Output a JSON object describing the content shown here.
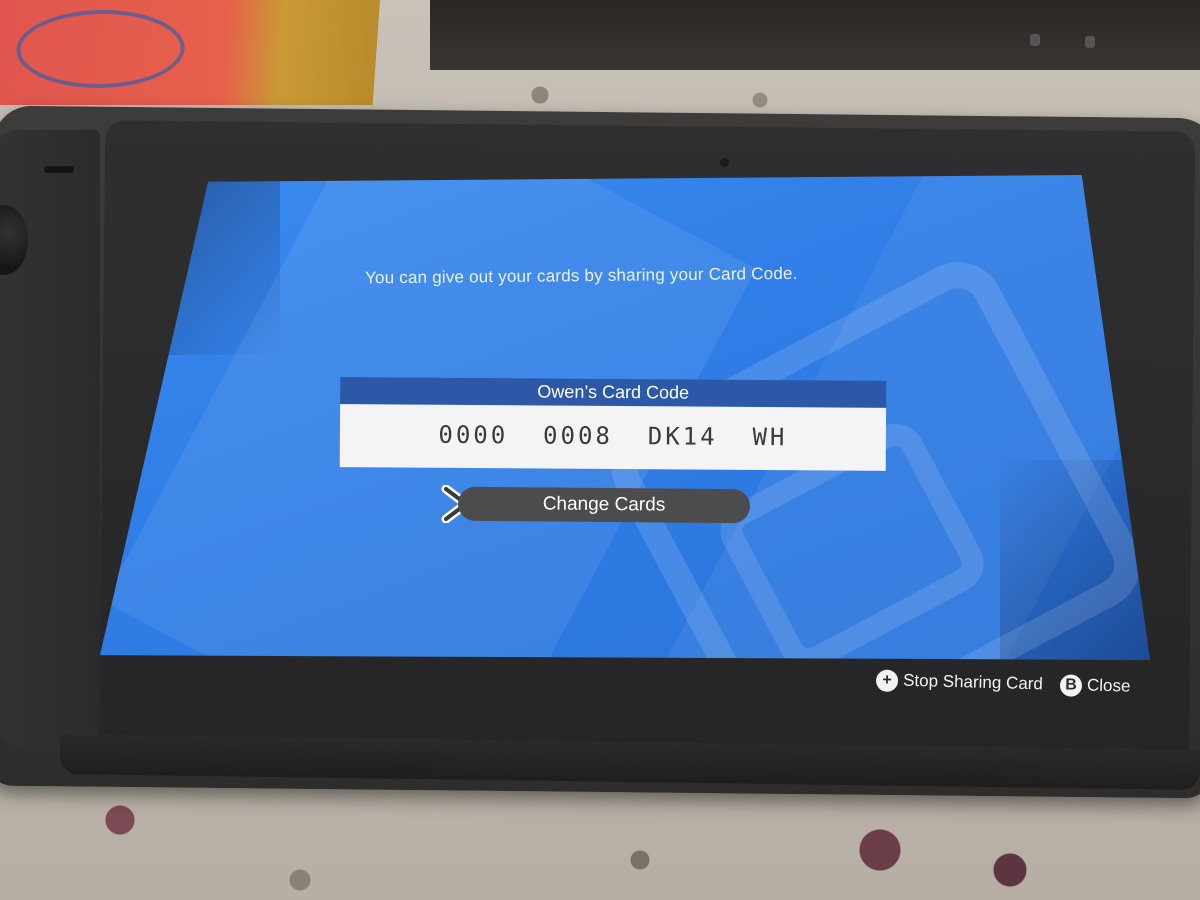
{
  "screen": {
    "info_text": "You can give out your cards by sharing your Card Code.",
    "card_code_title": "Owen’s Card Code",
    "card_code_value": "0000  0008  DK14  WH",
    "change_cards_label": "Change Cards"
  },
  "footer": {
    "stop_sharing": {
      "glyph": "+",
      "label": "Stop Sharing Card"
    },
    "close": {
      "glyph": "B",
      "label": "Close"
    }
  },
  "colors": {
    "screen_blue": "#2f7de6",
    "header_blue": "#2d58a8",
    "code_bg": "#f4f4f6",
    "button_gray": "#4c4c4e"
  },
  "icons": {
    "cursor": "chevron-right-icon",
    "plus_button": "plus-button-icon",
    "b_button": "b-button-icon"
  }
}
